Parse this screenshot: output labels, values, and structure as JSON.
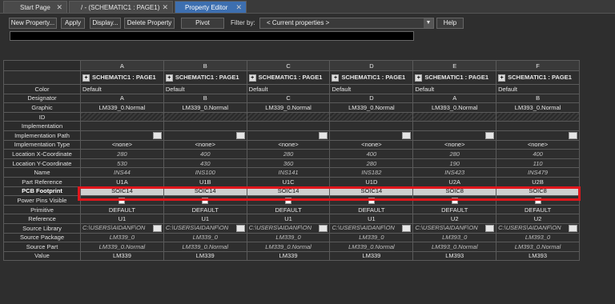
{
  "tabs": [
    {
      "label": "Start Page",
      "active": false
    },
    {
      "label": "/ - (SCHEMATIC1 : PAGE1)",
      "active": false
    },
    {
      "label": "Property Editor",
      "active": true
    }
  ],
  "toolbar": {
    "new_property": "New Property...",
    "apply": "Apply",
    "display": "Display...",
    "delete_property": "Delete Property",
    "pivot": "Pivot",
    "filter_label": "Filter by:",
    "filter_value": "< Current properties >",
    "help": "Help"
  },
  "columns": [
    "A",
    "B",
    "C",
    "D",
    "E",
    "F"
  ],
  "schematic": "SCHEMATIC1 : PAGE1",
  "rows": {
    "color": {
      "label": "Color",
      "values": [
        "Default",
        "Default",
        "Default",
        "Default",
        "Default",
        "Default"
      ]
    },
    "designator": {
      "label": "Designator",
      "values": [
        "A",
        "B",
        "C",
        "D",
        "A",
        "B"
      ]
    },
    "graphic": {
      "label": "Graphic",
      "values": [
        "LM339_0.Normal",
        "LM339_0.Normal",
        "LM339_0.Normal",
        "LM339_0.Normal",
        "LM393_0.Normal",
        "LM393_0.Normal"
      ]
    },
    "id": {
      "label": "ID"
    },
    "implementation": {
      "label": "Implementation"
    },
    "implementation_path": {
      "label": "Implementation Path"
    },
    "implementation_type": {
      "label": "Implementation Type",
      "values": [
        "<none>",
        "<none>",
        "<none>",
        "<none>",
        "<none>",
        "<none>"
      ]
    },
    "loc_x": {
      "label": "Location X-Coordinate",
      "values": [
        "280",
        "400",
        "280",
        "400",
        "280",
        "400"
      ]
    },
    "loc_y": {
      "label": "Location Y-Coordinate",
      "values": [
        "530",
        "430",
        "360",
        "280",
        "190",
        "110"
      ]
    },
    "name": {
      "label": "Name",
      "values": [
        "INS44",
        "INS100",
        "INS141",
        "INS182",
        "INS423",
        "INS479"
      ]
    },
    "part_reference": {
      "label": "Part Reference",
      "values": [
        "U1A",
        "U1B",
        "U1C",
        "U1D",
        "U2A",
        "U2B"
      ]
    },
    "pcb_footprint": {
      "label": "PCB Footprint",
      "values": [
        "SOIC14",
        "SOIC14",
        "SOIC14",
        "SOIC14",
        "SOIC8",
        "SOIC8"
      ]
    },
    "power_pins_visible": {
      "label": "Power Pins Visible"
    },
    "primitive": {
      "label": "Primitive",
      "values": [
        "DEFAULT",
        "DEFAULT",
        "DEFAULT",
        "DEFAULT",
        "DEFAULT",
        "DEFAULT"
      ]
    },
    "reference": {
      "label": "Reference",
      "values": [
        "U1",
        "U1",
        "U1",
        "U1",
        "U2",
        "U2"
      ]
    },
    "source_library": {
      "label": "Source Library",
      "values": [
        "C:\\USERS\\AIDANF\\ON",
        "C:\\USERS\\AIDANF\\ON",
        "C:\\USERS\\AIDANF\\ON",
        "C:\\USERS\\AIDANF\\ON",
        "C:\\USERS\\AIDANF\\ON",
        "C:\\USERS\\AIDANF\\ON"
      ]
    },
    "source_package": {
      "label": "Source Package",
      "values": [
        "LM339_0",
        "LM339_0",
        "LM339_0",
        "LM339_0",
        "LM393_0",
        "LM393_0"
      ]
    },
    "source_part": {
      "label": "Source Part",
      "values": [
        "LM339_0.Normal",
        "LM339_0.Normal",
        "LM339_0.Normal",
        "LM339_0.Normal",
        "LM393_0.Normal",
        "LM393_0.Normal"
      ]
    },
    "value": {
      "label": "Value",
      "values": [
        "LM339",
        "LM339",
        "LM339",
        "LM339",
        "LM393",
        "LM393"
      ]
    }
  },
  "colors": {
    "highlight": "#e0161c",
    "active_tab": "#3d6fb0"
  }
}
